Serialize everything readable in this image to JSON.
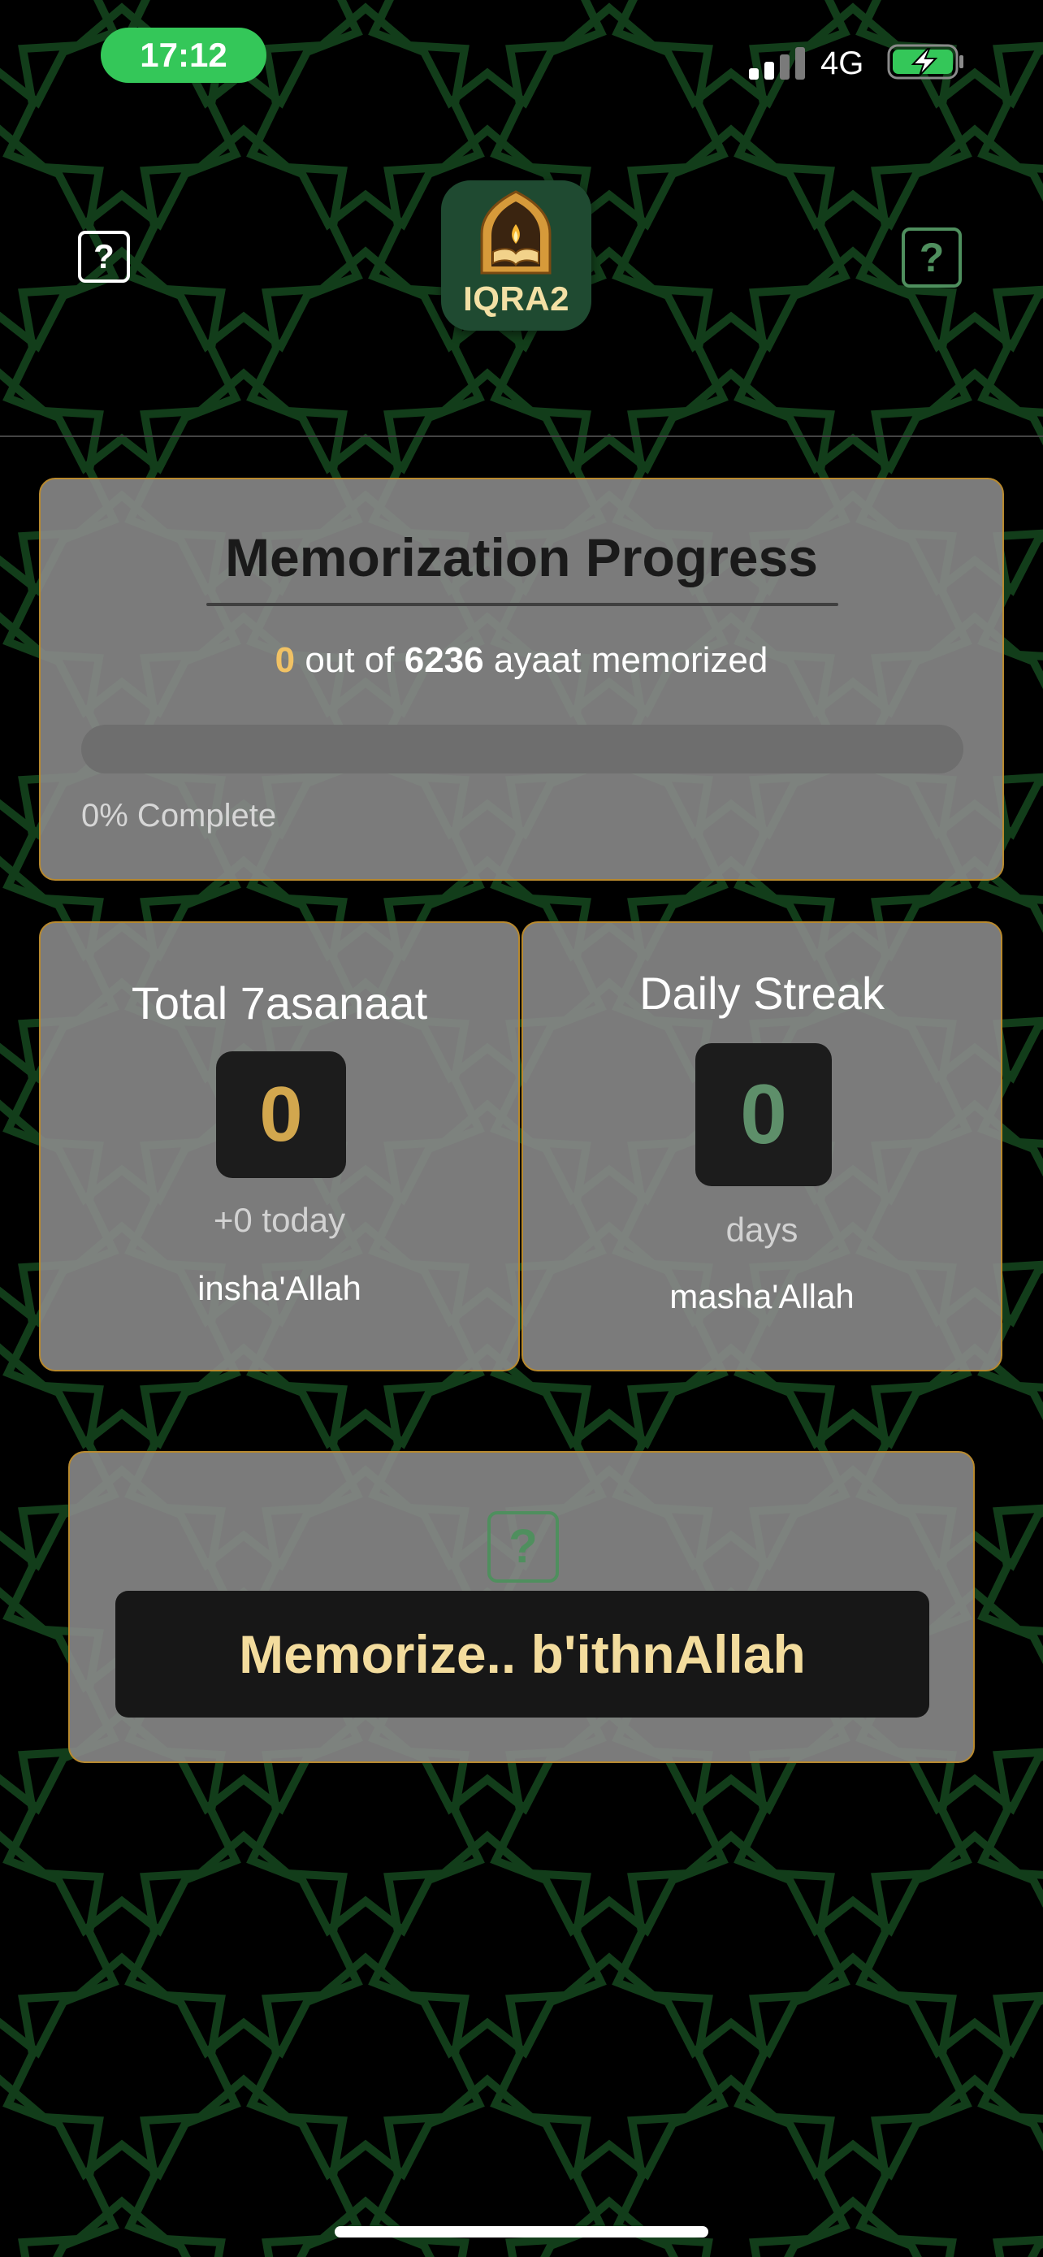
{
  "status_bar": {
    "time": "17:12",
    "network": "4G",
    "signal_icon": "cellular-signal-icon",
    "battery_icon": "battery-charging-icon",
    "time_pill_color": "#34c759"
  },
  "header": {
    "logo_text": "IQRA2",
    "logo_icon": "lantern-book-icon",
    "left_icon": "help-icon",
    "right_icon": "help-icon"
  },
  "progress": {
    "title": "Memorization Progress",
    "memorized": "0",
    "out_of_text": "out of",
    "total": "6236",
    "suffix": "ayaat memorized",
    "percent": 0,
    "percent_text": "0% Complete"
  },
  "hasanaat": {
    "title": "Total 7asanaat",
    "value": "0",
    "today": "+0 today",
    "foot": "insha'Allah"
  },
  "streak": {
    "title": "Daily Streak",
    "value": "0",
    "unit": "days",
    "foot": "masha'Allah"
  },
  "cta": {
    "button_label": "Memorize.. b'ithnAllah",
    "icon": "help-icon"
  },
  "colors": {
    "accent_gold": "#f1c264",
    "accent_green": "#4f8f5e",
    "card_border": "#b8892e",
    "pattern_green": "#123d1a"
  }
}
